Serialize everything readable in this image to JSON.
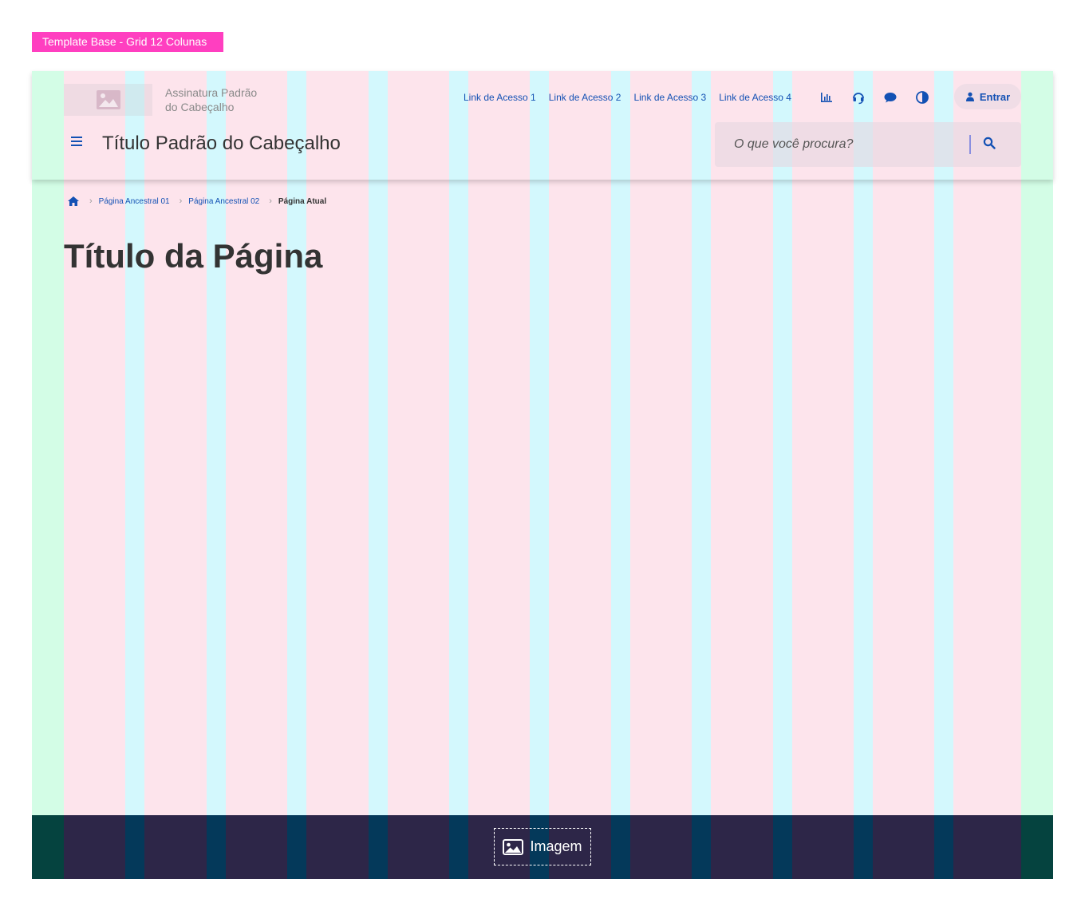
{
  "template_tag": "Template Base - Grid 12 Colunas",
  "header": {
    "signature_line1": "Assinatura Padrão",
    "signature_line2": "do Cabeçalho",
    "links": [
      "Link de Acesso 1",
      "Link de Acesso 2",
      "Link de Acesso 3",
      "Link de Acesso 4"
    ],
    "tools": [
      "chart-icon",
      "headset-icon",
      "chat-icon",
      "contrast-icon"
    ],
    "login_label": "Entrar",
    "title": "Título Padrão do Cabeçalho",
    "search_placeholder": "O que você procura?"
  },
  "breadcrumb": {
    "items": [
      "Página Ancestral 01",
      "Página Ancestral 02"
    ],
    "current": "Página Atual"
  },
  "page": {
    "title": "Título da Página"
  },
  "footer": {
    "image_label": "Imagem"
  },
  "colors": {
    "primary": "#1351b4",
    "tag": "#ff3fc0",
    "grid_margin": "#d3fde6",
    "grid_column": "#fde4ec",
    "grid_gutter": "#d3f8fd",
    "footer_bg": "#2d2648"
  }
}
